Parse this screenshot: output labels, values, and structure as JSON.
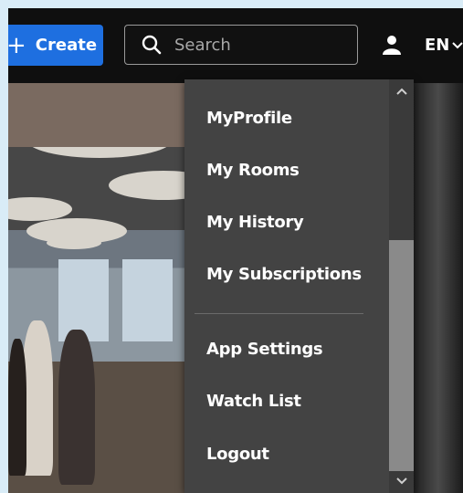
{
  "header": {
    "create_label": "Create",
    "search_placeholder": "Search",
    "language": "EN"
  },
  "menu": {
    "items": [
      "MyProfile",
      "My Rooms",
      "My History",
      "My Subscriptions"
    ],
    "items2": [
      "App Settings",
      "Watch List",
      "Logout"
    ]
  },
  "colors": {
    "accent": "#1e6fe0",
    "menu_bg": "#434343",
    "page_bg": "#d9ecf7"
  },
  "icons": [
    "plus-icon",
    "search-icon",
    "user-icon",
    "chevron-down-icon",
    "chevron-up-icon"
  ]
}
